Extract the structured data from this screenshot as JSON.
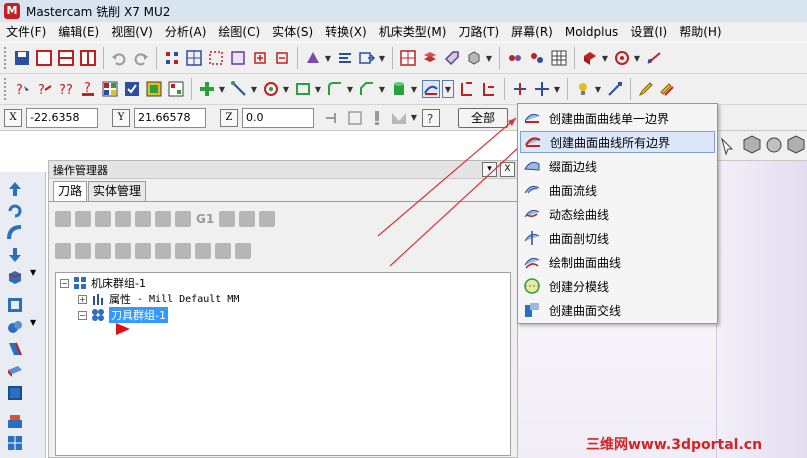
{
  "window": {
    "title": "Mastercam 铣削 X7 MU2"
  },
  "menu": [
    "文件(F)",
    "编辑(E)",
    "视图(V)",
    "分析(A)",
    "绘图(C)",
    "实体(S)",
    "转换(X)",
    "机床类型(M)",
    "刀路(T)",
    "屏幕(R)",
    "Moldplus",
    "设置(I)",
    "帮助(H)"
  ],
  "coords": {
    "x_label": "X",
    "x_value": "-22.6358",
    "y_label": "Y",
    "y_value": "21.66578",
    "z_label": "Z",
    "z_value": "0.0",
    "all_button": "全部"
  },
  "manager": {
    "title": "操作管理器",
    "tabs": [
      "刀路",
      "实体管理"
    ],
    "pin_glyph": "▾",
    "close_glyph": "X",
    "tool_text": "G1",
    "tree": {
      "machine_group": "机床群组-1",
      "properties_label": "属性",
      "properties_detail": "- Mill Default MM",
      "tool_group": "刀具群组-1"
    }
  },
  "popup_menu": {
    "items": [
      "创建曲面曲线单一边界",
      "创建曲面曲线所有边界",
      "缀面边线",
      "曲面流线",
      "动态绘曲线",
      "曲面剖切线",
      "绘制曲面曲线",
      "创建分模线",
      "创建曲面交线"
    ],
    "highlighted_index": 1
  },
  "watermark": "三维网www.3dportal.cn",
  "colors": {
    "accent": "#3399ff",
    "highlight": "#dce8fa",
    "arrow": "#e03030"
  }
}
